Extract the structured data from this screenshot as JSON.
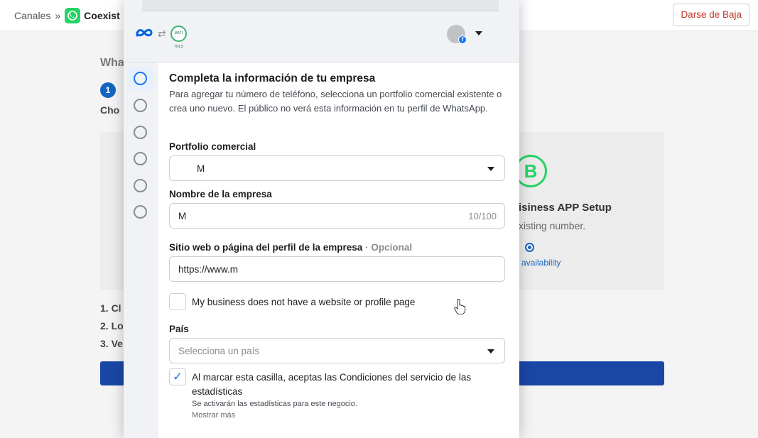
{
  "background": {
    "breadcrumb": {
      "root": "Canales",
      "separator": "»",
      "current": "Coexist"
    },
    "unsubscribe_label": "Darse de Baja",
    "title_partial": "Wha",
    "step_number": "1",
    "choose_partial": "Cho",
    "card": {
      "badge_letter": "B",
      "setup_title": "isiness APP Setup",
      "existing_text": "xisting number.",
      "availability_text": "availability"
    },
    "list_items": [
      "1. Cl",
      "2. Lo",
      "3. Ve"
    ],
    "colors": {
      "whatsapp_green": "#25d366",
      "primary_blue": "#1a47a6"
    }
  },
  "popup": {
    "brand_icon_text": "MATI TOLS",
    "form": {
      "title": "Completa la información de tu empresa",
      "description": "Para agregar tu número de teléfono, selecciona un portfolio comercial existente o crea uno nuevo. El público no verá esta información en tu perfil de WhatsApp.",
      "portfolio": {
        "label": "Portfolio comercial",
        "value": "M"
      },
      "company_name": {
        "label": "Nombre de la empresa",
        "value": "M",
        "counter": "10/100"
      },
      "website": {
        "label": "Sitio web o página del perfil de la empresa",
        "optional": "· Opcional",
        "value": "https://www.m"
      },
      "no_website_checkbox": {
        "label": "My business does not have a website or profile page",
        "checked": false
      },
      "country": {
        "label": "País",
        "placeholder": "Selecciona un país"
      },
      "consent": {
        "checked": true,
        "text": "Al marcar esta casilla, aceptas las Condiciones del servicio de las estadísticas",
        "subtext": "Se activarán las estadísticas para este negocio.",
        "more_link": "Mostrar más"
      }
    },
    "stepper": {
      "total_steps": 6,
      "active_step": 1
    },
    "colors": {
      "meta_blue": "#0064e0",
      "fb_blue": "#1877f2"
    }
  }
}
